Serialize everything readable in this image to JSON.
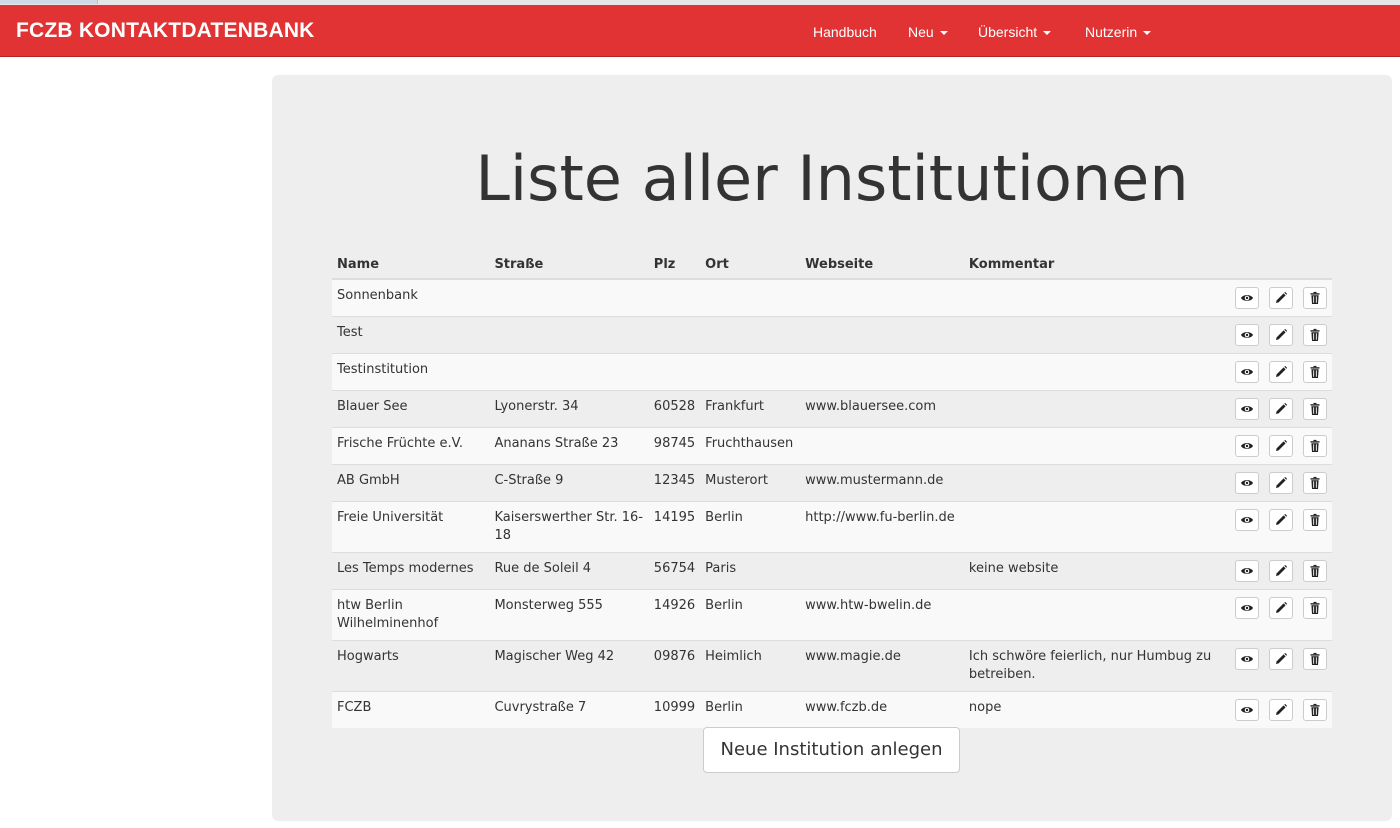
{
  "navbar": {
    "brand": "FCZB KONTAKTDATENBANK",
    "bg_color": "#e13333",
    "items": [
      {
        "label": "Handbuch",
        "dropdown": false
      },
      {
        "label": "Neu",
        "dropdown": true
      },
      {
        "label": "Übersicht",
        "dropdown": true
      },
      {
        "label": "Nutzerin",
        "dropdown": true
      }
    ]
  },
  "main": {
    "title": "Liste aller Institutionen",
    "columns": [
      "Name",
      "Straße",
      "Plz",
      "Ort",
      "Webseite",
      "Kommentar"
    ],
    "action_icons": [
      "eye-icon",
      "pencil-icon",
      "trash-icon"
    ],
    "rows": [
      {
        "name": "Sonnenbank",
        "strasse": "",
        "plz": "",
        "ort": "",
        "webseite": "",
        "kommentar": ""
      },
      {
        "name": "Test",
        "strasse": "",
        "plz": "",
        "ort": "",
        "webseite": "",
        "kommentar": ""
      },
      {
        "name": "Testinstitution",
        "strasse": "",
        "plz": "",
        "ort": "",
        "webseite": "",
        "kommentar": ""
      },
      {
        "name": "Blauer See",
        "strasse": "Lyonerstr. 34",
        "plz": "60528",
        "ort": "Frankfurt",
        "webseite": "www.blauersee.com",
        "kommentar": ""
      },
      {
        "name": "Frische Früchte e.V.",
        "strasse": "Ananans Straße 23",
        "plz": "98745",
        "ort": "Fruchthausen",
        "webseite": "",
        "kommentar": ""
      },
      {
        "name": "AB GmbH",
        "strasse": "C-Straße 9",
        "plz": "12345",
        "ort": "Musterort",
        "webseite": "www.mustermann.de",
        "kommentar": ""
      },
      {
        "name": "Freie Universität",
        "strasse": "Kaiserswerther Str. 16-18",
        "plz": "14195",
        "ort": "Berlin",
        "webseite": "http://www.fu-berlin.de",
        "kommentar": ""
      },
      {
        "name": "Les Temps modernes",
        "strasse": "Rue de Soleil 4",
        "plz": "56754",
        "ort": "Paris",
        "webseite": "",
        "kommentar": "keine website"
      },
      {
        "name": "htw Berlin Wilhelminenhof",
        "strasse": "Monsterweg 555",
        "plz": "14926",
        "ort": "Berlin",
        "webseite": "www.htw-bwelin.de",
        "kommentar": ""
      },
      {
        "name": "Hogwarts",
        "strasse": "Magischer Weg 42",
        "plz": "09876",
        "ort": "Heimlich",
        "webseite": "www.magie.de",
        "kommentar": "Ich schwöre feierlich, nur Humbug zu betreiben."
      },
      {
        "name": "FCZB",
        "strasse": "Cuvrystraße 7",
        "plz": "10999",
        "ort": "Berlin",
        "webseite": "www.fczb.de",
        "kommentar": "nope"
      }
    ],
    "new_button_label": "Neue Institution anlegen"
  }
}
